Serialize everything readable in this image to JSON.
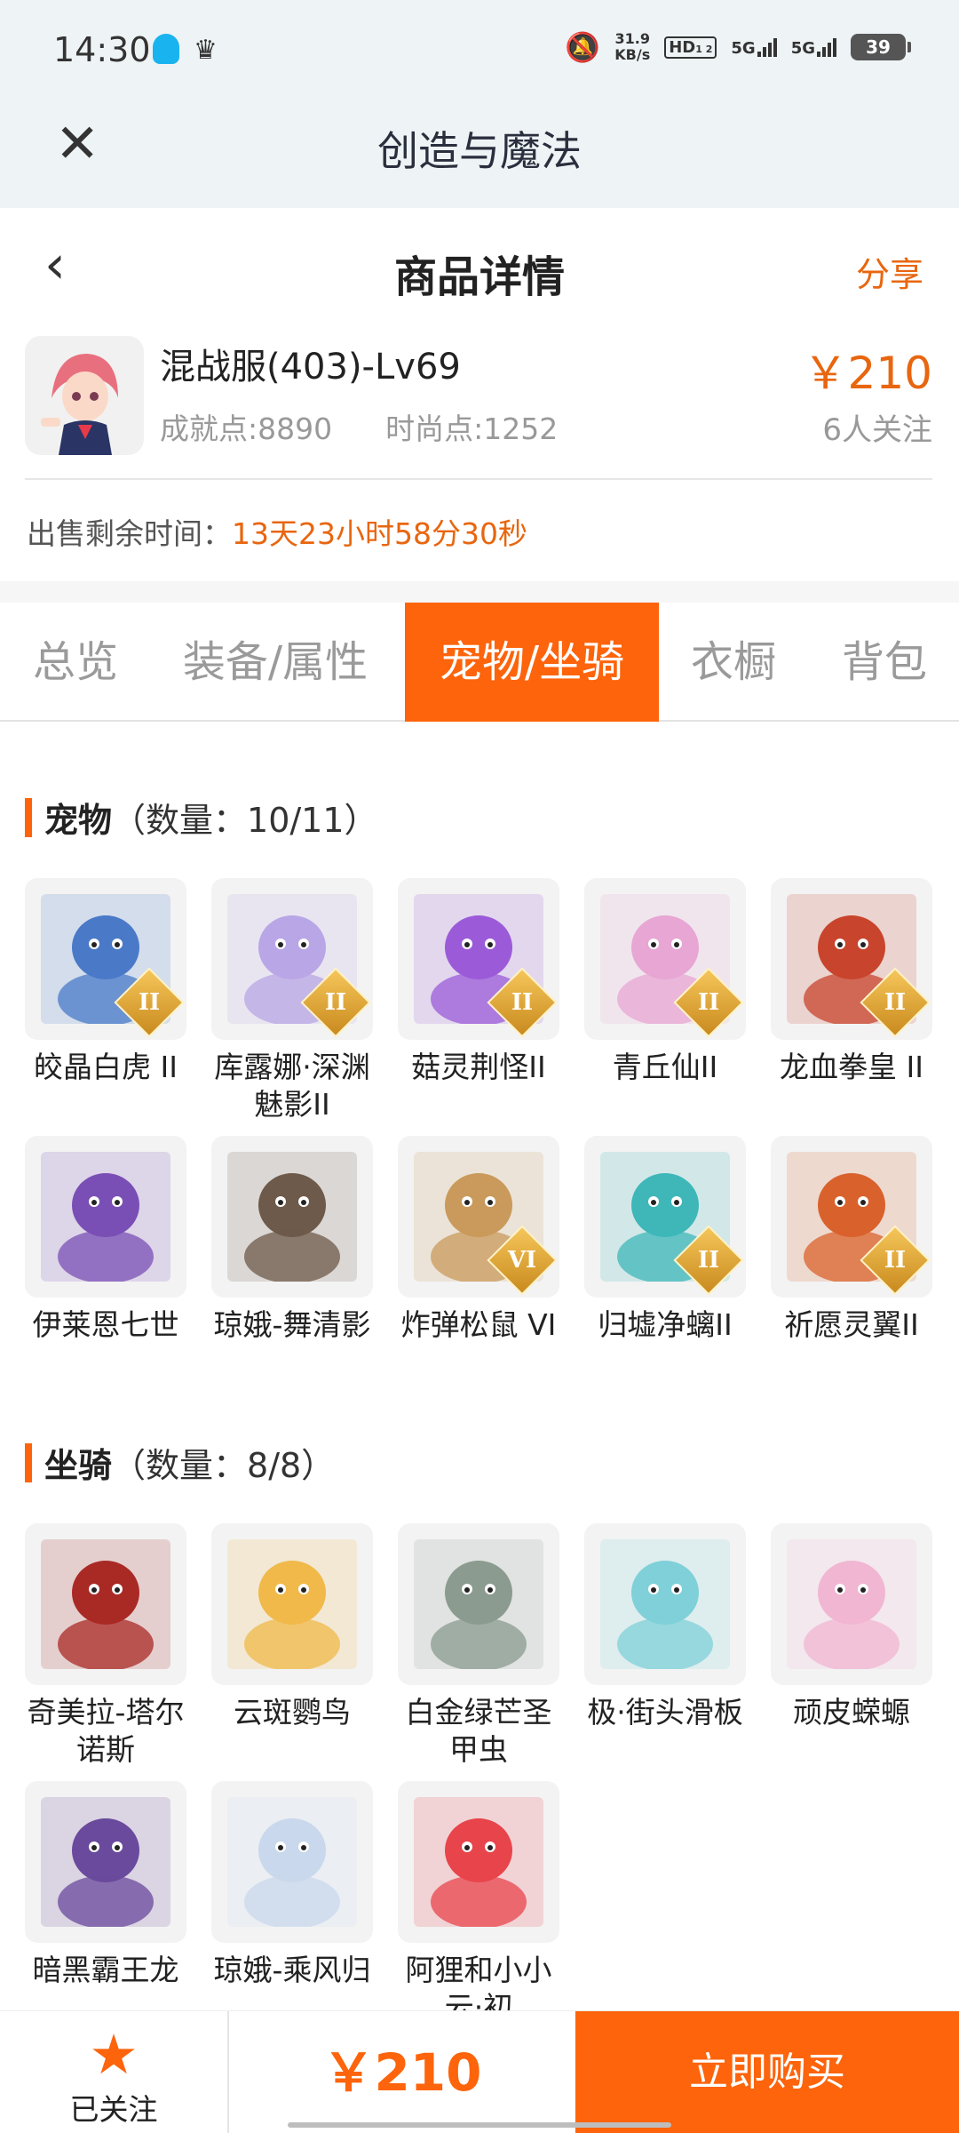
{
  "status_bar": {
    "time": "14:30",
    "speed_value": "31.9",
    "speed_unit": "KB/s",
    "hd_label": "HD",
    "hd_sub": "1 2",
    "net1": "5G",
    "net2": "5G",
    "battery": "39"
  },
  "app_bar": {
    "title": "创造与魔法"
  },
  "header": {
    "title": "商品详情",
    "share": "分享"
  },
  "product": {
    "name": "混战服(403)-Lv69",
    "achievement": "成就点:8890",
    "fashion": "时尚点:1252",
    "price": "￥210",
    "followers": "6人关注"
  },
  "sale_time": {
    "label": "出售剩余时间：",
    "value": "13天23小时58分30秒"
  },
  "tabs": [
    {
      "label": "总览"
    },
    {
      "label": "装备/属性"
    },
    {
      "label": "宠物/坐骑",
      "active": true
    },
    {
      "label": "衣橱"
    },
    {
      "label": "背包"
    }
  ],
  "pets": {
    "title": "宠物",
    "count": "（数量：10/11）",
    "items": [
      {
        "name": "皎晶白虎 II",
        "badge": "II",
        "icon": "white-tiger-icon",
        "color": "#4a79c8"
      },
      {
        "name": "库露娜·深渊魅影II",
        "badge": "II",
        "icon": "kuluna-icon",
        "color": "#b9a6e6"
      },
      {
        "name": "菇灵荆怪II",
        "badge": "II",
        "icon": "mushroom-spirit-icon",
        "color": "#9b5bd8"
      },
      {
        "name": "青丘仙II",
        "badge": "II",
        "icon": "fox-fairy-icon",
        "color": "#e7a6d3"
      },
      {
        "name": "龙血拳皇 II",
        "badge": "II",
        "icon": "dragon-boxer-icon",
        "color": "#c8442c"
      },
      {
        "name": "伊莱恩七世",
        "badge": "",
        "icon": "elaine-icon",
        "color": "#7a4fb5"
      },
      {
        "name": "琼娥-舞清影",
        "badge": "",
        "icon": "qiong-e-dancer-icon",
        "color": "#6d5a4a"
      },
      {
        "name": "炸弹松鼠 VI",
        "badge": "VI",
        "icon": "bomb-squirrel-icon",
        "color": "#c99a5b"
      },
      {
        "name": "归墟净螭II",
        "badge": "II",
        "icon": "water-dragon-icon",
        "color": "#3fb7b9"
      },
      {
        "name": "祈愿灵翼II",
        "badge": "II",
        "icon": "wish-wing-bird-icon",
        "color": "#d9622c"
      }
    ]
  },
  "mounts": {
    "title": "坐骑",
    "count": "（数量：8/8）",
    "items": [
      {
        "name": "奇美拉-塔尔诺斯",
        "icon": "chimera-icon",
        "color": "#a92a25"
      },
      {
        "name": "云斑鹦鸟",
        "icon": "parrot-icon",
        "color": "#f0b94a"
      },
      {
        "name": "白金绿芒圣甲虫",
        "icon": "scarab-icon",
        "color": "#8b9b8f"
      },
      {
        "name": "极·街头滑板",
        "icon": "skateboard-icon",
        "color": "#7fd0d8"
      },
      {
        "name": "顽皮蝾螈",
        "icon": "axolotl-icon",
        "color": "#f1b6d2"
      },
      {
        "name": "暗黑霸王龙",
        "icon": "dark-trex-icon",
        "color": "#6a4a9c"
      },
      {
        "name": "琼娥-乘风归",
        "icon": "qiong-e-wind-icon",
        "color": "#c9d8ec"
      },
      {
        "name": "阿狸和小小云·初",
        "icon": "ali-cloud-icon",
        "color": "#e8444c"
      }
    ]
  },
  "bottom": {
    "fav_label": "已关注",
    "price": "￥210",
    "buy": "立即购买"
  }
}
